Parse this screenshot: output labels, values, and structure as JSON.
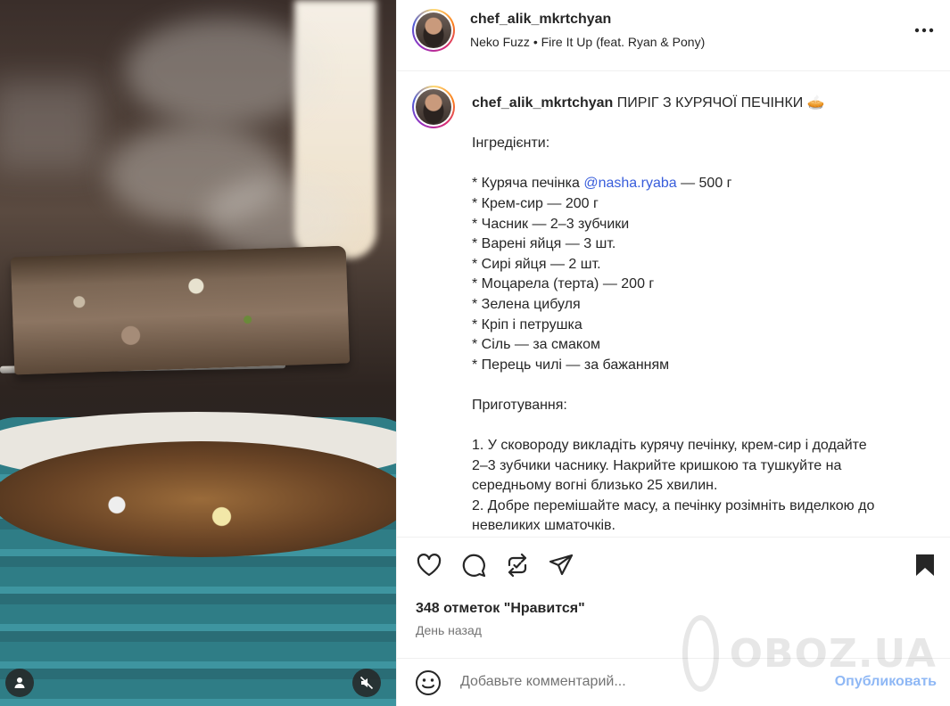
{
  "post": {
    "username": "chef_alik_mkrtchyan",
    "music": {
      "artist": "Neko Fuzz",
      "separator": "•",
      "track": "Fire It Up (feat. Ryan & Pony)"
    }
  },
  "caption": {
    "title": "ПИРІГ З КУРЯЧОЇ ПЕЧІНКИ",
    "title_emoji": "🥧",
    "ingredients_heading": "Інгредієнти:",
    "ingredient_1_prefix": "* Куряча печінка ",
    "ingredient_1_mention": "@nasha.ryaba",
    "ingredient_1_suffix": " — 500 г",
    "ingredients": [
      "* Крем-сир — 200 г",
      "* Часник — 2–3 зубчики",
      "* Варені яйця — 3 шт.",
      "* Сирі яйця — 2 шт.",
      "* Моцарела (терта) — 200 г",
      "* Зелена цибуля",
      "* Кріп і петрушка",
      "* Сіль — за смаком",
      "* Перець чилі — за бажанням"
    ],
    "preparation_heading": "Приготування:",
    "steps": [
      "1. У сковороду викладіть курячу печінку, крем-сир і додайте",
      "2–3 зубчики часнику. Накрийте кришкою та тушкуйте на",
      "середньому вогні близько 25 хвилин.",
      "2. Добре перемішайте масу, а печінку розімніть виделкою до",
      "невеликих шматочків."
    ]
  },
  "engagement": {
    "likes": "348 отметок \"Нравится\"",
    "time": "День назад"
  },
  "comment": {
    "placeholder": "Добавьте комментарий...",
    "publish_label": "Опубликовать"
  },
  "watermark": {
    "text": "OBOZ.UA"
  },
  "icons": {
    "like": "heart-icon",
    "comment": "comment-icon",
    "repost": "repost-icon",
    "share": "share-icon",
    "save": "bookmark-icon",
    "emoji": "emoji-icon",
    "more": "more-icon",
    "user_tag": "user-tag-icon",
    "mute": "muted-speaker-icon"
  },
  "colors": {
    "mention": "#385ddb",
    "publish": "#8fb8f5",
    "secondary_text": "#737373"
  }
}
